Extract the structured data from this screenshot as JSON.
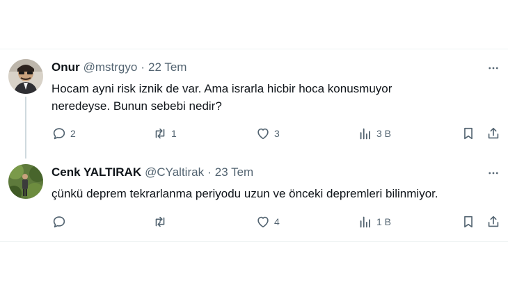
{
  "tweets": [
    {
      "name": "Onur",
      "handle": "@mstrgyo",
      "separator": "·",
      "date": "22 Tem",
      "text_lines": [
        "Hocam ayni risk iznik de var. Ama israrla hicbir hoca konusmuyor",
        "neredeyse. Bunun sebebi nedir?"
      ],
      "replies": "2",
      "retweets": "1",
      "likes": "3",
      "views": "3 B"
    },
    {
      "name": "Cenk YALTIRAK",
      "handle": "@CYaltirak",
      "separator": "·",
      "date": "23 Tem",
      "text_lines": [
        "çünkü deprem tekrarlanma periyodu uzun ve önceki depremleri bilinmiyor."
      ],
      "replies": "",
      "retweets": "",
      "likes": "4",
      "views": "1 B"
    }
  ],
  "icons": {
    "more": "more-horizontal-icon",
    "reply": "reply-icon",
    "retweet": "retweet-icon",
    "like": "heart-icon",
    "views": "analytics-icon",
    "bookmark": "bookmark-icon",
    "share": "share-icon"
  },
  "colors": {
    "text": "#0f1419",
    "muted": "#536471",
    "divider": "#eff3f4",
    "thread_line": "#cfd9de"
  }
}
